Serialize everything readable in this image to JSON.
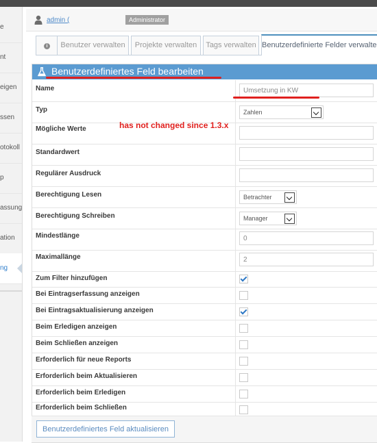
{
  "sidebar": {
    "items": [
      {
        "label": "e"
      },
      {
        "label": "nt"
      },
      {
        "label": "eigen"
      },
      {
        "label": "ssen"
      },
      {
        "label": "otokoll"
      },
      {
        "label": "p"
      },
      {
        "label": "assung"
      },
      {
        "label": "ation"
      },
      {
        "label": "ng"
      }
    ]
  },
  "user": {
    "name": "admin (",
    "role": "Administrator"
  },
  "tabs": [
    {
      "label": ""
    },
    {
      "label": "Benutzer verwalten"
    },
    {
      "label": "Projekte verwalten"
    },
    {
      "label": "Tags verwalten"
    },
    {
      "label": "Benutzerdefinierte Felder verwalten"
    }
  ],
  "panel": {
    "title": "Benutzerdefiniertes Feld bearbeiten"
  },
  "annotation": "has not changed since 1.3.x",
  "fields": {
    "name": {
      "label": "Name",
      "value": "Umsetzung in KW"
    },
    "type": {
      "label": "Typ",
      "value": "Zahlen"
    },
    "possible_values": {
      "label": "Mögliche Werte",
      "value": ""
    },
    "default_value": {
      "label": "Standardwert",
      "value": ""
    },
    "regex": {
      "label": "Regulärer Ausdruck",
      "value": ""
    },
    "read_access": {
      "label": "Berechtigung Lesen",
      "value": "Betrachter"
    },
    "write_access": {
      "label": "Berechtigung Schreiben",
      "value": "Manager"
    },
    "min_length": {
      "label": "Mindestlänge",
      "value": "0"
    },
    "max_length": {
      "label": "Maximallänge",
      "value": "2"
    }
  },
  "checkboxes": [
    {
      "label": "Zum Filter hinzufügen",
      "checked": true
    },
    {
      "label": "Bei Eintragserfassung anzeigen",
      "checked": false
    },
    {
      "label": "Bei Eintragsaktualisierung anzeigen",
      "checked": true
    },
    {
      "label": "Beim Erledigen anzeigen",
      "checked": false
    },
    {
      "label": "Beim Schließen anzeigen",
      "checked": false
    },
    {
      "label": "Erforderlich für neue Reports",
      "checked": false
    },
    {
      "label": "Erforderlich beim Aktualisieren",
      "checked": false
    },
    {
      "label": "Erforderlich beim Erledigen",
      "checked": false
    },
    {
      "label": "Erforderlich beim Schließen",
      "checked": false
    }
  ],
  "footer": {
    "submit_label": "Benutzerdefiniertes Feld aktualisieren"
  },
  "colors": {
    "accent": "#5b9bd1",
    "annotation": "#e0201e",
    "check": "#2d78c5"
  }
}
